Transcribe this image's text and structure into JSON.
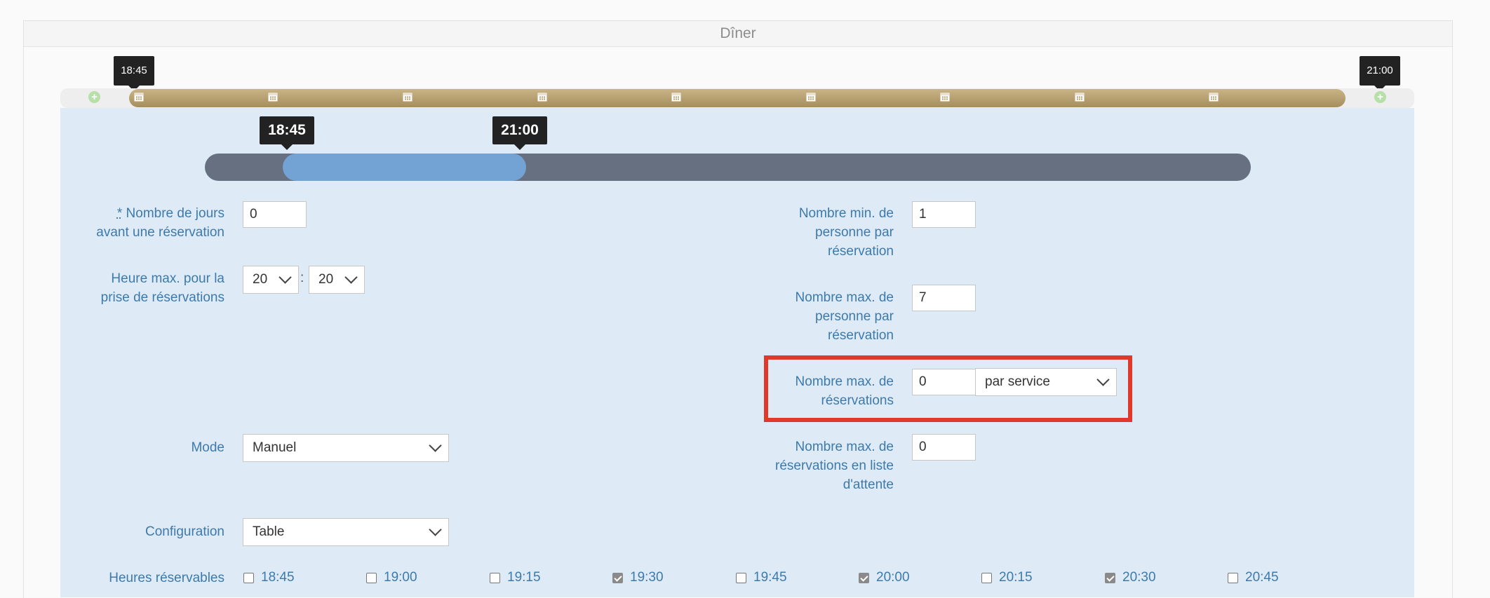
{
  "section": {
    "title": "Dîner"
  },
  "timeline": {
    "start_tooltip": "18:45",
    "end_tooltip": "21:00"
  },
  "range_slider": {
    "start_label": "18:45",
    "end_label": "21:00",
    "range_fraction": [
      0.1,
      0.335
    ]
  },
  "form": {
    "days_before": {
      "required_mark": "*",
      "label_line1": " Nombre de jours",
      "label_line2": "avant une réservation",
      "value": "0"
    },
    "max_hour": {
      "label_line1": "Heure max. pour la",
      "label_line2": "prise de réservations",
      "hour": "20",
      "minute": "20",
      "separator": ":"
    },
    "min_persons": {
      "label_line1": "Nombre min. de",
      "label_line2": "personne par",
      "label_line3": "réservation",
      "value": "1"
    },
    "max_persons": {
      "label_line1": "Nombre max. de",
      "label_line2": "personne par",
      "label_line3": "réservation",
      "value": "7"
    },
    "max_reservations": {
      "label_line1": "Nombre max. de",
      "label_line2": "réservations",
      "value": "0",
      "period": "par service"
    },
    "mode": {
      "label": "Mode",
      "value": "Manuel"
    },
    "max_waitlist": {
      "label_line1": "Nombre max. de",
      "label_line2": "réservations en liste",
      "label_line3": "d'attente",
      "value": "0"
    },
    "configuration": {
      "label": "Configuration",
      "value": "Table"
    },
    "bookable_hours": {
      "label": "Heures réservables",
      "slots": [
        {
          "time": "18:45",
          "checked": false
        },
        {
          "time": "19:00",
          "checked": false
        },
        {
          "time": "19:15",
          "checked": false
        },
        {
          "time": "19:30",
          "checked": true
        },
        {
          "time": "19:45",
          "checked": false
        },
        {
          "time": "20:00",
          "checked": true
        },
        {
          "time": "20:15",
          "checked": false
        },
        {
          "time": "20:30",
          "checked": true
        },
        {
          "time": "20:45",
          "checked": false
        }
      ]
    }
  },
  "icons": {
    "timeline_marker": "calendar-icon",
    "timeline_add": "plus-circle-icon",
    "dropdown": "chevron-down-icon"
  },
  "colors": {
    "timeline_gold": "#b9a170",
    "slider_track": "#667080",
    "slider_range": "#72a3d4",
    "panel": "#deebf6",
    "label": "#3d7aab",
    "highlight": "#e0392b"
  }
}
